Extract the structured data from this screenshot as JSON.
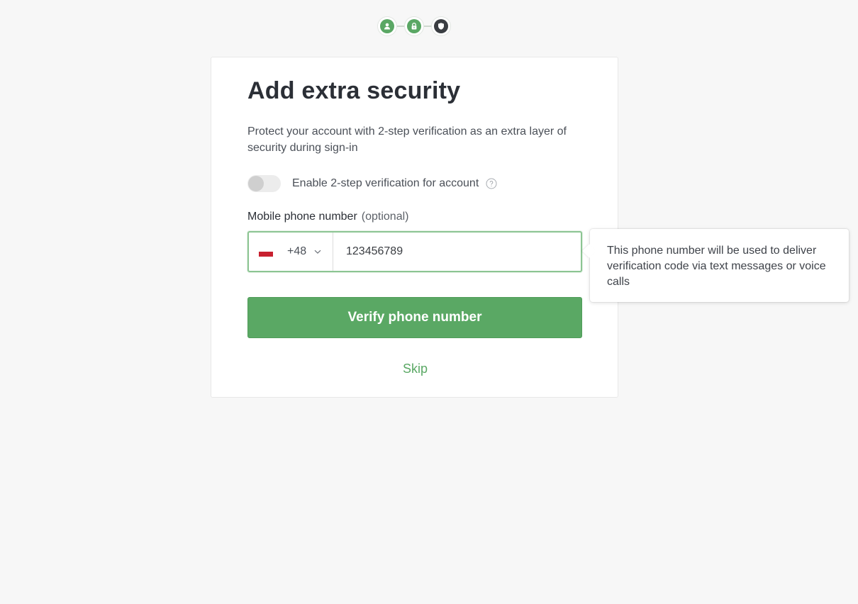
{
  "steps": [
    {
      "icon": "user-icon",
      "state": "done"
    },
    {
      "icon": "lock-icon",
      "state": "done"
    },
    {
      "icon": "shield-icon",
      "state": "current"
    }
  ],
  "card": {
    "title": "Add extra security",
    "description": "Protect your account with 2-step verification as an extra layer of security during sign-in",
    "toggle": {
      "label": "Enable 2-step verification for account",
      "enabled": false,
      "help_icon": "question-circle-icon"
    },
    "phone": {
      "label": "Mobile phone number",
      "optional_text": "(optional)",
      "country_code": "+48",
      "country_flag": "poland-flag-icon",
      "value": "123456789"
    },
    "verify_button_label": "Verify phone number",
    "skip_label": "Skip"
  },
  "tooltip": {
    "text": "This phone number will be used to deliver verification code via text messages or voice calls"
  },
  "colors": {
    "accent": "#5aa864",
    "background": "#f7f7f7",
    "step_current": "#3a3d42"
  }
}
